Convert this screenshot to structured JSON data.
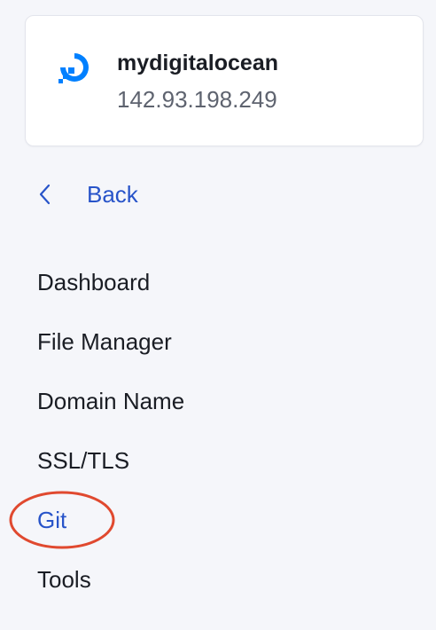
{
  "server": {
    "name": "mydigitalocean",
    "ip": "142.93.198.249",
    "logo_icon": "digitalocean-logo-icon",
    "brand_color": "#0080ff"
  },
  "back": {
    "label": "Back",
    "icon": "chevron-left-icon"
  },
  "nav": {
    "items": [
      {
        "label": "Dashboard",
        "active": false
      },
      {
        "label": "File Manager",
        "active": false
      },
      {
        "label": "Domain Name",
        "active": false
      },
      {
        "label": "SSL/TLS",
        "active": false
      },
      {
        "label": "Git",
        "active": true
      },
      {
        "label": "Tools",
        "active": false
      }
    ]
  },
  "colors": {
    "accent": "#2854c9",
    "text": "#1a1d24",
    "muted": "#5e636f",
    "background": "#f5f6fa",
    "annotation": "#e0492f"
  }
}
